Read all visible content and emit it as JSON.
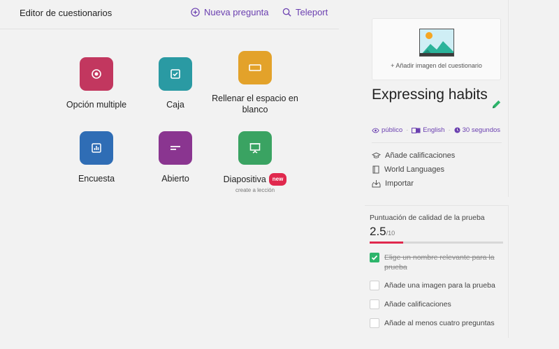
{
  "editor": {
    "title": "Editor de cuestionarios",
    "new_question": "Nueva pregunta",
    "teleport": "Teleport"
  },
  "question_types": [
    {
      "label": "Opción multiple",
      "color": "#c2375f",
      "icon": "radio-icon"
    },
    {
      "label": "Caja",
      "color": "#2a9aa3",
      "icon": "checkbox-icon"
    },
    {
      "label": "Rellenar el espacio en blanco",
      "color": "#e3a22a",
      "icon": "blank-icon"
    },
    {
      "label": "Encuesta",
      "color": "#2f6db5",
      "icon": "poll-icon"
    },
    {
      "label": "Abierto",
      "color": "#8a3590",
      "icon": "open-text-icon"
    },
    {
      "label": "Diapositiva",
      "color": "#3aa362",
      "icon": "slide-icon",
      "badge": "new",
      "sub": "create a lección"
    }
  ],
  "quiz": {
    "add_image": "+ Añadir imagen del cuestionario",
    "title": "Expressing habits",
    "visibility": "público",
    "language": "English",
    "time": "30 segundos",
    "options": [
      {
        "label": "Añade calificaciones",
        "icon": "graduation-cap-icon"
      },
      {
        "label": "World Languages",
        "icon": "book-icon"
      },
      {
        "label": "Importar",
        "icon": "import-icon"
      }
    ]
  },
  "score": {
    "title": "Puntuación de calidad de la prueba",
    "value": "2.5",
    "max": "/10",
    "progress": 0.25,
    "accent": "#e0284d",
    "checks": [
      {
        "label": "Elige un nombre relevante para la prueba",
        "done": true
      },
      {
        "label": "Añade una imagen para la prueba",
        "done": false
      },
      {
        "label": "Añade calificaciones",
        "done": false
      },
      {
        "label": "Añade al menos cuatro preguntas",
        "done": false
      }
    ]
  }
}
